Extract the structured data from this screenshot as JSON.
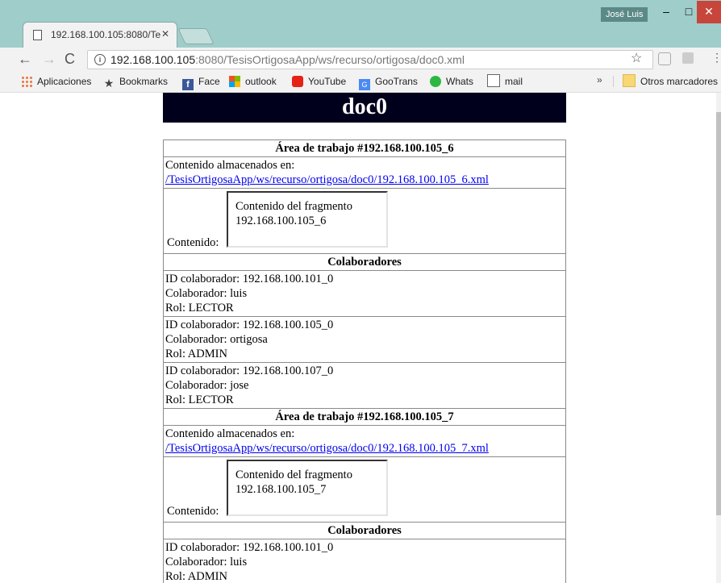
{
  "window": {
    "user": "José Luis",
    "minimize": "–",
    "maximize": "□",
    "close": "✕"
  },
  "tab": {
    "title": "192.168.100.105:8080/Te",
    "close": "✕"
  },
  "toolbar": {
    "back": "←",
    "forward": "→",
    "reload": "C",
    "url_host": "192.168.100.105",
    "url_rest": ":8080/TesisOrtigosaApp/ws/recurso/ortigosa/doc0.xml",
    "star": "☆",
    "menu": "⋮"
  },
  "bookmarks": {
    "items": [
      {
        "label": "Aplicaciones",
        "icon": "apps-icon"
      },
      {
        "label": "Bookmarks",
        "icon": "star-icon"
      },
      {
        "label": "Face",
        "icon": "facebook-icon"
      },
      {
        "label": "outlook",
        "icon": "microsoft-icon"
      },
      {
        "label": "YouTube",
        "icon": "youtube-icon"
      },
      {
        "label": "GooTrans",
        "icon": "google-translate-icon"
      },
      {
        "label": "Whats",
        "icon": "whatsapp-icon"
      },
      {
        "label": "mail",
        "icon": "page-icon"
      }
    ],
    "more": "»",
    "other": "Otros marcadores"
  },
  "page": {
    "heading": "doc0",
    "areas": [
      {
        "title": "Área de trabajo #192.168.100.105_6",
        "stored_label": "Contenido almacenados en:",
        "stored_link": "/TesisOrtigosaApp/ws/recurso/ortigosa/doc0/192.168.100.105_6.xml",
        "content_label": "Contenido:",
        "fragment_line1": "Contenido del fragmento",
        "fragment_line2": "192.168.100.105_6",
        "collab_header": "Colaboradores",
        "collaborators": [
          {
            "id": "ID colaborador: 192.168.100.101_0",
            "name": "Colaborador: luis",
            "role": "Rol: LECTOR"
          },
          {
            "id": "ID colaborador: 192.168.100.105_0",
            "name": "Colaborador: ortigosa",
            "role": "Rol: ADMIN"
          },
          {
            "id": "ID colaborador: 192.168.100.107_0",
            "name": "Colaborador: jose",
            "role": "Rol: LECTOR"
          }
        ]
      },
      {
        "title": "Área de trabajo #192.168.100.105_7",
        "stored_label": "Contenido almacenados en:",
        "stored_link": "/TesisOrtigosaApp/ws/recurso/ortigosa/doc0/192.168.100.105_7.xml",
        "content_label": "Contenido:",
        "fragment_line1": "Contenido del fragmento",
        "fragment_line2": "192.168.100.105_7",
        "collab_header": "Colaboradores",
        "collaborators": [
          {
            "id": "ID colaborador: 192.168.100.101_0",
            "name": "Colaborador: luis",
            "role": "Rol: ADMIN"
          }
        ]
      }
    ]
  }
}
